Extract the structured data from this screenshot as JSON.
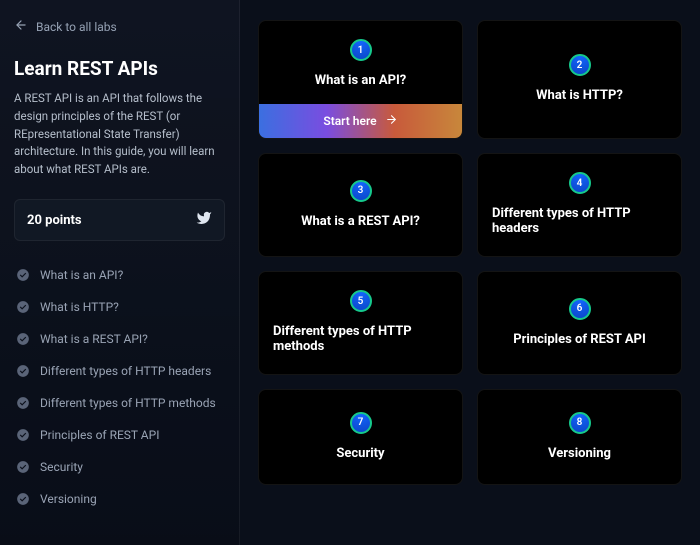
{
  "back_label": "Back to all labs",
  "title": "Learn REST APIs",
  "description": "A REST API is an API that follows the design principles of the REST (or REpresentational State Transfer) architecture. In this guide, you will learn about what REST APIs are.",
  "points_label": "20 points",
  "nav": [
    "What is an API?",
    "What is HTTP?",
    "What is a REST API?",
    "Different types of HTTP headers",
    "Different types of HTTP methods",
    "Principles of REST API",
    "Security",
    "Versioning"
  ],
  "start_label": "Start here",
  "cards": [
    {
      "n": "1",
      "title": "What is an API?",
      "featured": true,
      "align": "center"
    },
    {
      "n": "2",
      "title": "What is HTTP?",
      "align": "center"
    },
    {
      "n": "3",
      "title": "What is a REST API?",
      "align": "center"
    },
    {
      "n": "4",
      "title": "Different types of HTTP headers",
      "align": "left"
    },
    {
      "n": "5",
      "title": "Different types of HTTP methods",
      "align": "left"
    },
    {
      "n": "6",
      "title": "Principles of REST API",
      "align": "center"
    },
    {
      "n": "7",
      "title": "Security",
      "align": "center"
    },
    {
      "n": "8",
      "title": "Versioning",
      "align": "center"
    }
  ]
}
